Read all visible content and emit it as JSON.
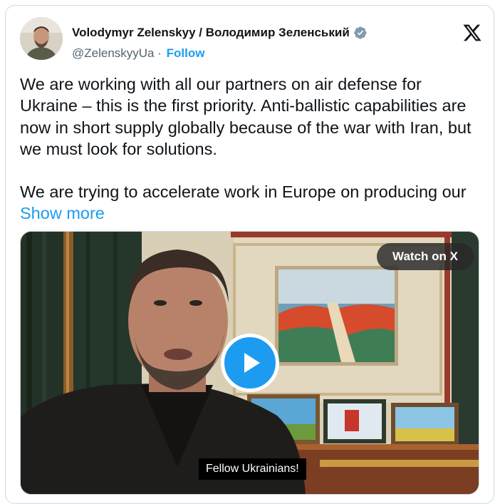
{
  "author": {
    "display_name": "Volodymyr Zelenskyy / Володимир Зеленський",
    "handle": "@ZelenskyyUa",
    "separator": "·",
    "follow_label": "Follow",
    "verified_color": "#829aab"
  },
  "tweet": {
    "paragraph_1": "We are working with all our partners on air defense for Ukraine – this is the first priority. Anti-ballistic capabilities are now in short supply globally because of the war with Iran, but we must look for solutions.",
    "paragraph_2_text": "We are trying to accelerate work in Europe on producing our",
    "show_more_label": "Show more"
  },
  "media": {
    "watch_label": "Watch on X",
    "caption": "Fellow Ukrainians!"
  },
  "icons": {
    "brand": "x-logo-icon",
    "verified": "verified-badge-icon",
    "play": "play-icon"
  },
  "colors": {
    "link": "#1d9bf0",
    "text": "#0f1419",
    "secondary": "#536471",
    "border": "#cfd9de"
  }
}
